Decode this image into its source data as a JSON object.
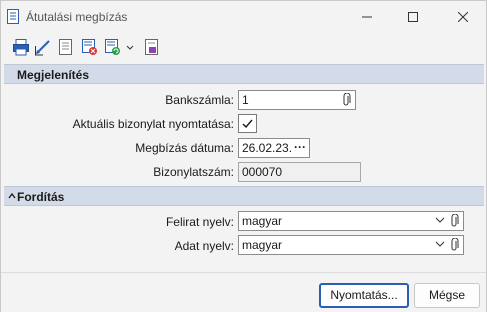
{
  "window": {
    "title": "Átutalási megbízás"
  },
  "toolbar": {
    "icons": [
      "print-icon",
      "edit-icon",
      "doc-list-icon",
      "doc-delete-icon",
      "doc-refresh-icon",
      "dropdown-chevron-icon",
      "doc-settings-icon"
    ]
  },
  "display_section": {
    "title": "Megjelenítés",
    "bank_account": {
      "label": "Bankszámla:",
      "value": "1"
    },
    "print_current": {
      "label": "Aktuális bizonylat nyomtatása:",
      "checked": true
    },
    "order_date": {
      "label": "Megbízás dátuma:",
      "value": "26.02.23."
    },
    "doc_number": {
      "label": "Bizonylatszám:",
      "value": "000070"
    }
  },
  "translation_section": {
    "title": "Fordítás",
    "caption_lang": {
      "label": "Felirat nyelv:",
      "value": "magyar"
    },
    "data_lang": {
      "label": "Adat nyelv:",
      "value": "magyar"
    }
  },
  "footer": {
    "print_label": "Nyomtatás...",
    "cancel_label": "Mégse"
  },
  "colors": {
    "section_bg": "#d3dbe8",
    "accent": "#2b5fb3"
  }
}
